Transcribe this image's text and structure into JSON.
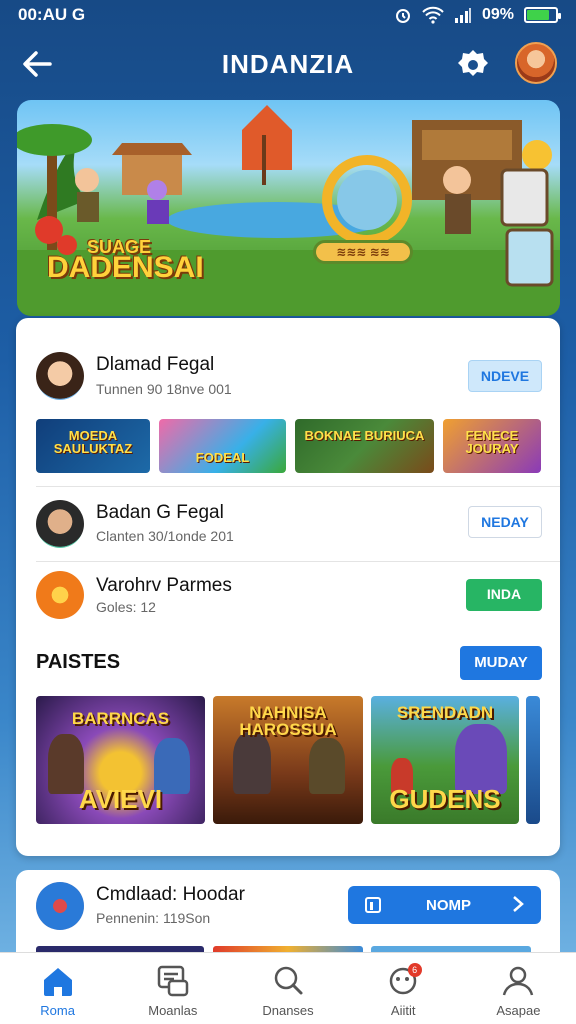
{
  "status_bar": {
    "time": "00:AU G",
    "battery_percent": "09%",
    "battery_level": 0.72
  },
  "header": {
    "title": "INDANZIA"
  },
  "banner": {
    "logo_line1": "SUAGE",
    "logo_line2": "DADENSAI",
    "portal_label": "≋≋≋ ≋≋"
  },
  "friends": [
    {
      "name": "Dlamad Fegal",
      "meta": "Tunnen 90 18nve 001",
      "action": "NDEVE"
    },
    {
      "name": "Badan G Fegal",
      "meta": "Clanten 30/1onde 201",
      "action": "NEDAY"
    },
    {
      "name": "Varohrv Parmes",
      "meta": "Goles: 12",
      "action": "INDA"
    }
  ],
  "thumbnails": [
    {
      "label": "MOEDA SAULUKTAZ"
    },
    {
      "label": "FODEAL"
    },
    {
      "label": "BOKNAE BURIUCA"
    },
    {
      "label": "FENECE JOURAY"
    }
  ],
  "section": {
    "title": "PAISTES",
    "button": "MUDAY"
  },
  "games": [
    {
      "top": "BARRNCAS",
      "bottom": "AVIEVI"
    },
    {
      "top": "NAHNISA HAROSSUA",
      "bottom": ""
    },
    {
      "top": "SRENDADN",
      "bottom": "GUDENS"
    }
  ],
  "featured": {
    "name": "Cmdlaad: Hoodar",
    "meta": "Pennenin: 119Son",
    "button": "NOMP"
  },
  "bottom_nav": [
    {
      "label": "Roma",
      "active": true
    },
    {
      "label": "Moanlas",
      "active": false
    },
    {
      "label": "Dnanses",
      "active": false
    },
    {
      "label": "Aiitit",
      "active": false,
      "badge": "6"
    },
    {
      "label": "Asapae",
      "active": false
    }
  ]
}
